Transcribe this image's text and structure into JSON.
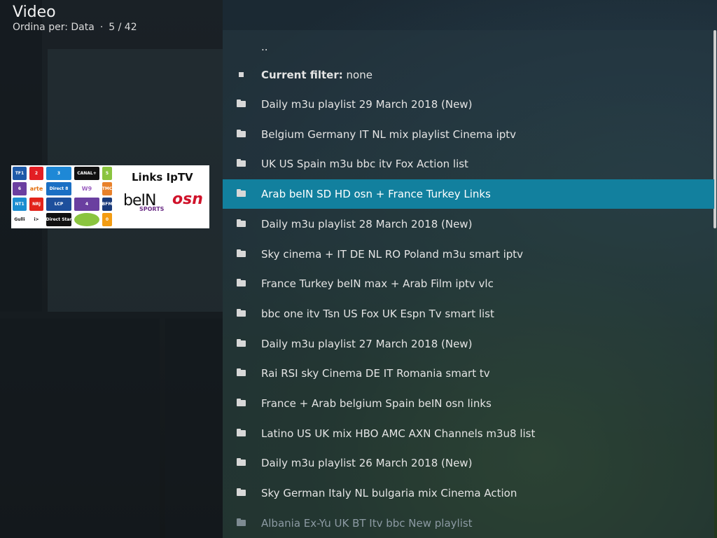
{
  "header": {
    "title": "Video",
    "sort_label": "Ordina per: Data",
    "separator": "·",
    "position": "5 / 42"
  },
  "thumbnail": {
    "title": "Links IpTV",
    "bein": "beIN",
    "bein_sub": "SPORTS",
    "osn": "osn",
    "logos": [
      "TF1",
      "2",
      "3",
      "CANAL+",
      "5",
      "6",
      "arte",
      "Direct 8",
      "W9",
      "TMC",
      "NT1",
      "NRJ",
      "LCP",
      "4",
      "BFM",
      "Gulli",
      "i>",
      "Direct Star",
      "",
      "0"
    ]
  },
  "list": {
    "parent": "..",
    "filter_label": "Current filter:",
    "filter_value": "none",
    "items": [
      "Daily m3u playlist 29 March 2018 (New)",
      "Belgium Germany IT NL mix playlist Cinema iptv",
      "UK US Spain m3u bbc itv Fox Action list",
      "Arab beIN SD HD osn + France Turkey Links",
      "Daily m3u playlist 28 March 2018 (New)",
      "Sky cinema + IT DE NL RO Poland m3u smart iptv",
      "France Turkey beIN max + Arab Film iptv vlc",
      "bbc one itv Tsn US Fox UK Espn Tv smart list",
      "Daily m3u playlist 27 March 2018 (New)",
      "Rai RSI sky Cinema DE IT Romania smart tv",
      "France + Arab belgium Spain beIN osn links",
      "Latino US UK mix HBO AMC AXN Channels m3u8 list",
      "Daily m3u playlist 26 March 2018 (New)",
      "Sky German Italy NL bulgaria mix Cinema Action",
      "Albania Ex-Yu UK BT Itv bbc New playlist"
    ],
    "selected_index": 3
  },
  "colors": {
    "selected_row": "#12809e",
    "accent_red": "#d0122a"
  }
}
